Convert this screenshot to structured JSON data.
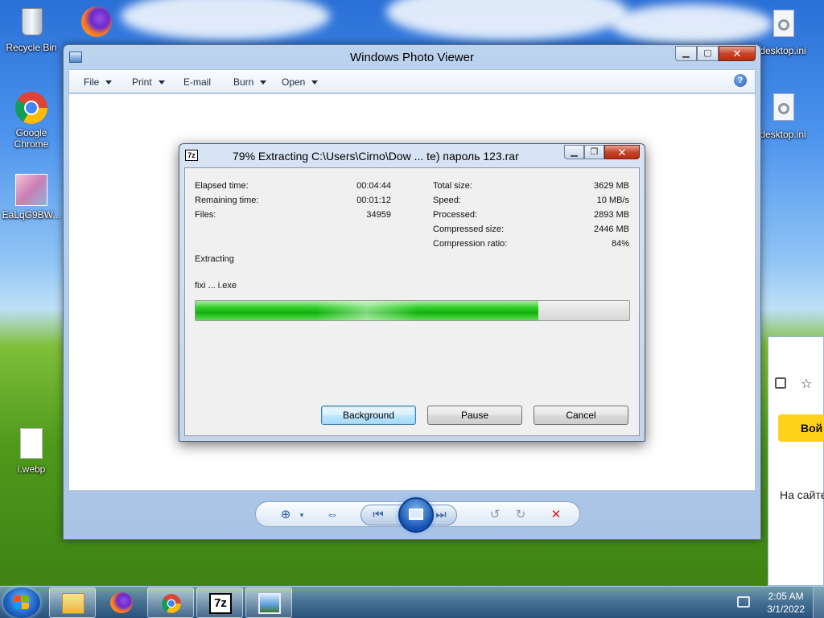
{
  "desktop": {
    "icons": [
      {
        "label": "Recycle Bin",
        "icon": "recycle-bin-icon"
      },
      {
        "label": "Google Chrome",
        "icon": "chrome-icon"
      },
      {
        "label": "EaLqG9BW...",
        "icon": "image-file-icon"
      },
      {
        "label": "i.webp",
        "icon": "file-icon"
      },
      {
        "label": "desktop.ini",
        "icon": "settings-file-icon"
      },
      {
        "label": "desktop.ini",
        "icon": "settings-file-icon"
      }
    ],
    "bg_window_text": {
      "button": "Вой",
      "line": "На сайте"
    }
  },
  "photo_viewer": {
    "title": "Windows Photo Viewer",
    "menus": [
      "File",
      "Print",
      "E-mail",
      "Burn",
      "Open"
    ],
    "help": "?"
  },
  "extract_dialog": {
    "app_badge": "7z",
    "title": "79% Extracting C:\\Users\\Cirno\\Dow ... te) пароль 123.rar",
    "left_stats": [
      {
        "label": "Elapsed time:",
        "value": "00:04:44"
      },
      {
        "label": "Remaining time:",
        "value": "00:01:12"
      },
      {
        "label": "Files:",
        "value": "34959"
      }
    ],
    "right_stats": [
      {
        "label": "Total size:",
        "value": "3629 MB"
      },
      {
        "label": "Speed:",
        "value": "10 MB/s"
      },
      {
        "label": "Processed:",
        "value": "2893 MB"
      },
      {
        "label": "Compressed size:",
        "value": "2446 MB"
      },
      {
        "label": "Compression ratio:",
        "value": "84%"
      }
    ],
    "operation": "Extracting",
    "current_file": "fixi ... i.exe",
    "progress_fraction": 0.79,
    "buttons": {
      "background": "Background",
      "pause": "Pause",
      "cancel": "Cancel"
    }
  },
  "taskbar": {
    "items": [
      {
        "name": "explorer",
        "icon": "folder-icon"
      },
      {
        "name": "firefox",
        "icon": "firefox-icon"
      },
      {
        "name": "chrome",
        "icon": "chrome-icon"
      },
      {
        "name": "7zip",
        "icon": "7zip-icon",
        "badge": "7z"
      },
      {
        "name": "photo-viewer",
        "icon": "photo-viewer-icon"
      }
    ],
    "time": "2:05 AM",
    "date": "3/1/2022"
  },
  "colors": {
    "progress": "#11b00f",
    "close": "#c7452a",
    "accent": "#1650b0"
  }
}
